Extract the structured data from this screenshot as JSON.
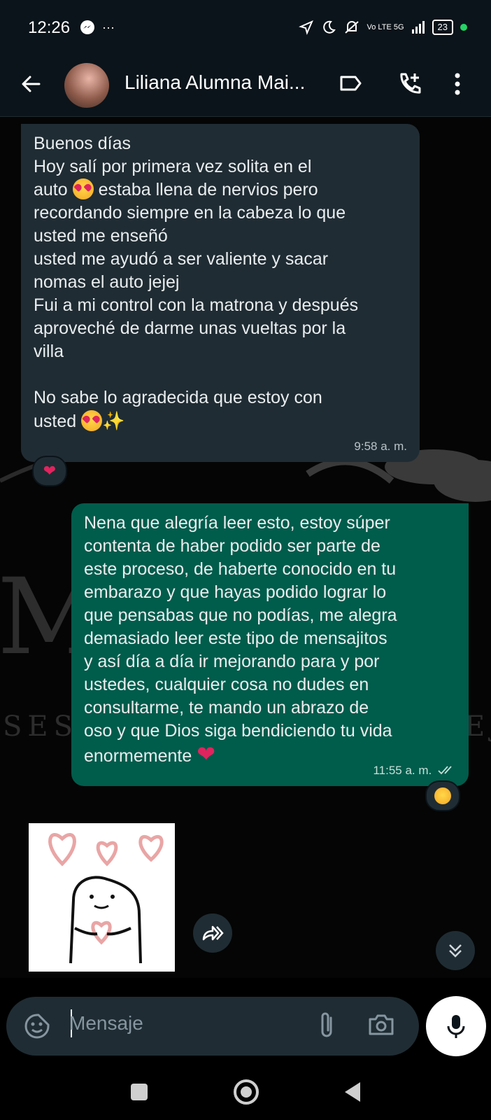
{
  "status_bar": {
    "time": "12:26",
    "extra": "···",
    "network": "Vo LTE 5G",
    "battery": "23"
  },
  "header": {
    "contact_name": "Liliana Alumna Mai..."
  },
  "messages": [
    {
      "direction": "incoming",
      "lines": [
        "Buenos días",
        "Hoy salí por primera vez solita en el",
        "auto",
        "estaba llena de nervios pero",
        "recordando siempre en la cabeza lo que",
        "usted me enseñó",
        "usted me ayudó a ser valiente y sacar",
        "nomas el auto jejej",
        "Fui a mi control con la matrona y después",
        "aproveché de darme unas vueltas por la",
        "villa",
        "No sabe lo agradecida que estoy con",
        "usted"
      ],
      "time": "9:58 a. m.",
      "reaction": "❤️"
    },
    {
      "direction": "outgoing",
      "lines": [
        "Nena que alegría leer esto, estoy súper",
        "contenta de haber podido ser parte de",
        "este proceso, de haberte conocido en tu",
        "embarazo y que hayas podido lograr lo",
        "que pensabas que no podías, me alegra",
        "demasiado leer este tipo de mensajitos",
        "y así día a día ir mejorando para y por",
        "ustedes, cualquier cosa no dudes en",
        "consultarme, te mando un abrazo de",
        "oso y que Dios siga bendiciendo tu vida",
        "enormemente"
      ],
      "time": "11:55 a. m.",
      "reaction": "🥰"
    }
  ],
  "composer": {
    "placeholder": "Mensaje"
  },
  "watermark": {
    "big_letter": "M",
    "side_text_left": "SES",
    "side_text_right": "EJ"
  },
  "colors": {
    "incoming_bubble": "#202c33",
    "outgoing_bubble": "#005c4b",
    "accent": "#25d366"
  }
}
